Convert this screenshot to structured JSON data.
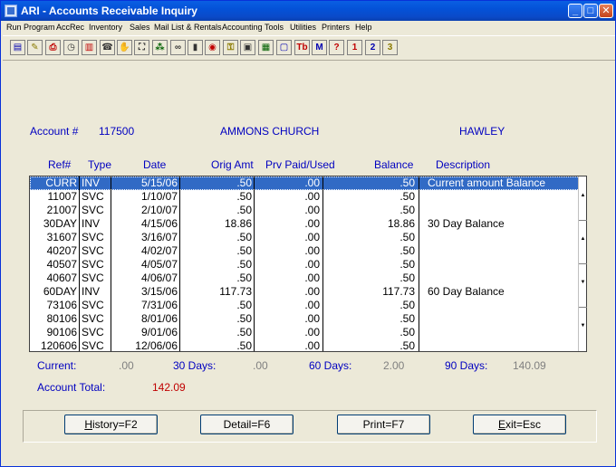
{
  "window": {
    "title": "ARI - Accounts Receivable Inquiry"
  },
  "menu": [
    "Run Program",
    "AccRec",
    "Inventory",
    "Sales",
    "Mail List & Rentals",
    "Accounting",
    "Tools",
    "Utilities",
    "Printers",
    "Help"
  ],
  "toolbar": [
    {
      "icon": "calculator-icon",
      "glyph": "▤"
    },
    {
      "icon": "notepad-icon",
      "glyph": "✎"
    },
    {
      "icon": "printer-icon",
      "glyph": "⎙"
    },
    {
      "icon": "clock-icon",
      "glyph": "◷"
    },
    {
      "icon": "book-icon",
      "glyph": "▥"
    },
    {
      "icon": "telephone-icon",
      "glyph": "☎"
    },
    {
      "icon": "stop-sign-icon",
      "glyph": "✋"
    },
    {
      "icon": "binoculars-icon",
      "glyph": "⛶"
    },
    {
      "icon": "network-icon",
      "glyph": "⁂"
    },
    {
      "icon": "glasses-icon",
      "glyph": "∞"
    },
    {
      "icon": "barcode-icon",
      "glyph": "▮"
    },
    {
      "icon": "target-icon",
      "glyph": "◉"
    },
    {
      "icon": "lock-icon",
      "glyph": "⚿"
    },
    {
      "icon": "camera-icon",
      "glyph": "▣"
    },
    {
      "icon": "bar-chart-icon",
      "glyph": "▦"
    },
    {
      "icon": "monitor-icon",
      "glyph": "▢"
    },
    {
      "icon": "tbg-icon",
      "glyph": "Tb"
    },
    {
      "icon": "m-circle-icon",
      "glyph": "M"
    },
    {
      "icon": "help-question-icon",
      "glyph": "?"
    },
    {
      "icon": "number-1-icon",
      "glyph": "1"
    },
    {
      "icon": "number-2-icon",
      "glyph": "2"
    },
    {
      "icon": "number-3-icon",
      "glyph": "3"
    }
  ],
  "account": {
    "label": "Account #",
    "number": "117500",
    "name": "AMMONS CHURCH",
    "city": "HAWLEY"
  },
  "columns": {
    "ref": "Ref#",
    "type": "Type",
    "date": "Date",
    "orig": "Orig Amt",
    "prv": "Prv Paid/Used",
    "bal": "Balance",
    "desc": "Description"
  },
  "rows": [
    {
      "ref": "CURR",
      "type": "INV",
      "date": "5/15/06",
      "orig": ".50",
      "prv": ".00",
      "bal": ".50",
      "desc": "Current amount Balance"
    },
    {
      "ref": "11007",
      "type": "SVC",
      "date": "1/10/07",
      "orig": ".50",
      "prv": ".00",
      "bal": ".50",
      "desc": ""
    },
    {
      "ref": "21007",
      "type": "SVC",
      "date": "2/10/07",
      "orig": ".50",
      "prv": ".00",
      "bal": ".50",
      "desc": ""
    },
    {
      "ref": "30DAY",
      "type": "INV",
      "date": "4/15/06",
      "orig": "18.86",
      "prv": ".00",
      "bal": "18.86",
      "desc": "30 Day Balance"
    },
    {
      "ref": "31607",
      "type": "SVC",
      "date": "3/16/07",
      "orig": ".50",
      "prv": ".00",
      "bal": ".50",
      "desc": ""
    },
    {
      "ref": "40207",
      "type": "SVC",
      "date": "4/02/07",
      "orig": ".50",
      "prv": ".00",
      "bal": ".50",
      "desc": ""
    },
    {
      "ref": "40507",
      "type": "SVC",
      "date": "4/05/07",
      "orig": ".50",
      "prv": ".00",
      "bal": ".50",
      "desc": ""
    },
    {
      "ref": "40607",
      "type": "SVC",
      "date": "4/06/07",
      "orig": ".50",
      "prv": ".00",
      "bal": ".50",
      "desc": ""
    },
    {
      "ref": "60DAY",
      "type": "INV",
      "date": "3/15/06",
      "orig": "117.73",
      "prv": ".00",
      "bal": "117.73",
      "desc": "60 Day Balance"
    },
    {
      "ref": "73106",
      "type": "SVC",
      "date": "7/31/06",
      "orig": ".50",
      "prv": ".00",
      "bal": ".50",
      "desc": ""
    },
    {
      "ref": "80106",
      "type": "SVC",
      "date": "8/01/06",
      "orig": ".50",
      "prv": ".00",
      "bal": ".50",
      "desc": ""
    },
    {
      "ref": "90106",
      "type": "SVC",
      "date": "9/01/06",
      "orig": ".50",
      "prv": ".00",
      "bal": ".50",
      "desc": ""
    },
    {
      "ref": "120606",
      "type": "SVC",
      "date": "12/06/06",
      "orig": ".50",
      "prv": ".00",
      "bal": ".50",
      "desc": ""
    }
  ],
  "summary": {
    "current_label": "Current:",
    "current_value": ".00",
    "d30_label": "30 Days:",
    "d30_value": ".00",
    "d60_label": "60 Days:",
    "d60_value": "2.00",
    "d90_label": "90 Days:",
    "d90_value": "140.09",
    "total_label": "Account Total:",
    "total_value": "142.09"
  },
  "buttons": {
    "history": {
      "key": "H",
      "rest": "istory=F2"
    },
    "detail": "Detail=F6",
    "print": "Print=F7",
    "exit": {
      "key": "E",
      "rest": "xit=Esc"
    }
  }
}
